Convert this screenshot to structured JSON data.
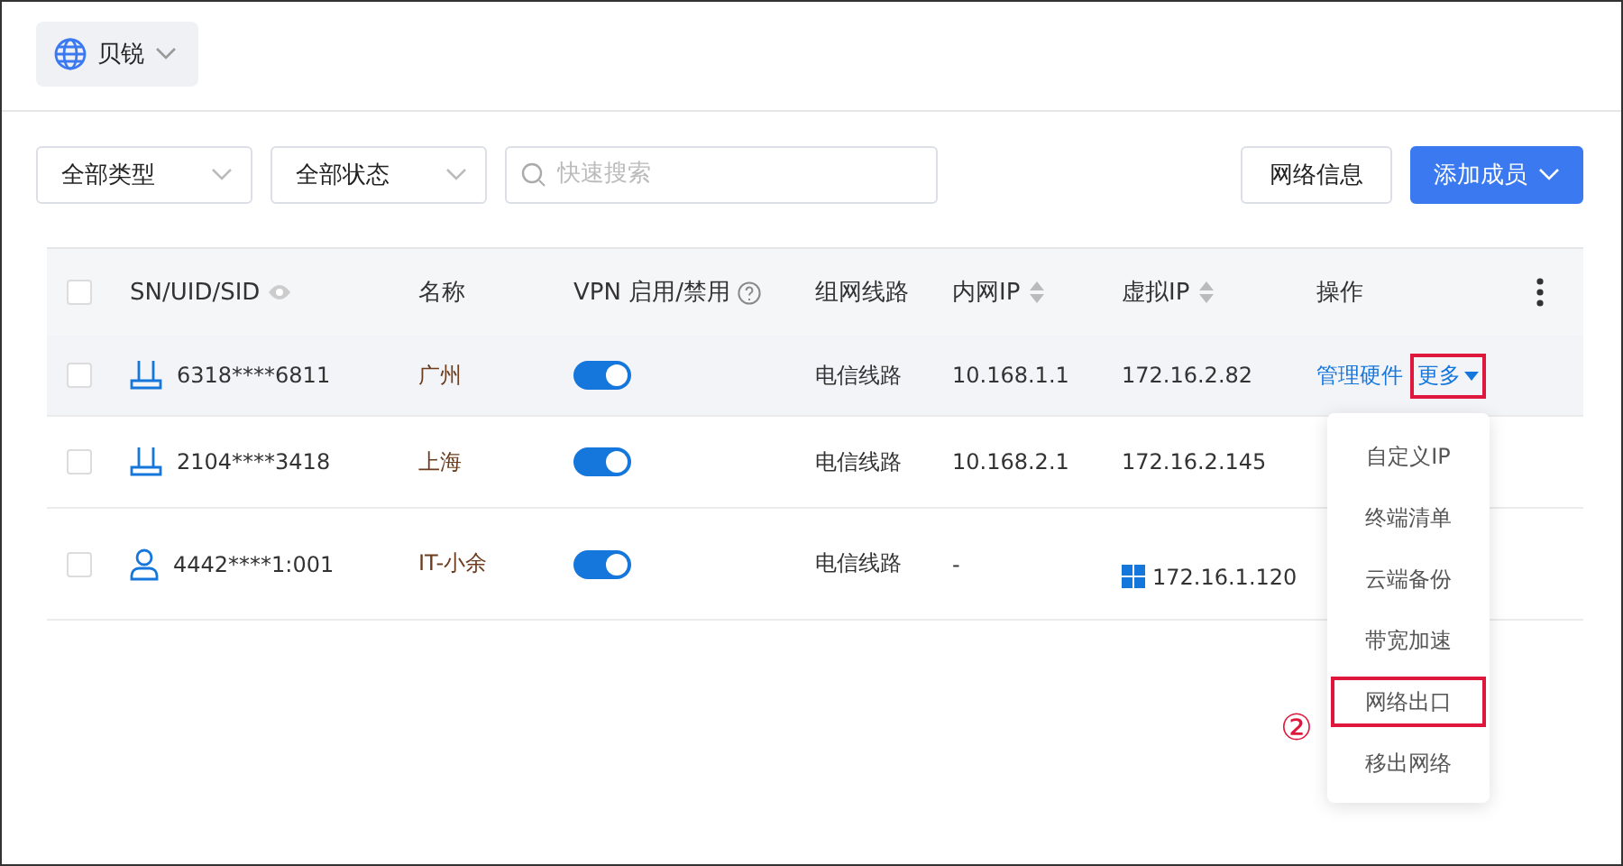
{
  "tenant": {
    "label": "贝锐"
  },
  "filters": [
    {
      "label": "全部类型"
    },
    {
      "label": "全部状态"
    }
  ],
  "search": {
    "placeholder": "快速搜索"
  },
  "buttons": [
    {
      "label": "网络信息",
      "kind": "default"
    },
    {
      "label": "添加成员",
      "kind": "primary"
    }
  ],
  "table": {
    "all_checked": false,
    "columns": [
      "SN/UID/SID",
      "名称",
      "VPN 启用/禁用",
      "组网线路",
      "内网IP",
      "虚拟IP",
      "操作"
    ],
    "rows": [
      {
        "kind": "router",
        "id": "6318****6811",
        "name": "广州",
        "vpn_on": true,
        "line": "电信线路",
        "lan_ip": "10.168.1.1",
        "virtual_ip": "172.16.2.82",
        "windows_icon": false,
        "actions": [
          "管理硬件",
          "更多"
        ],
        "selected": true,
        "checked": false
      },
      {
        "kind": "router",
        "id": "2104****3418",
        "name": "上海",
        "vpn_on": true,
        "line": "电信线路",
        "lan_ip": "10.168.2.1",
        "virtual_ip": "172.16.2.145",
        "windows_icon": false,
        "actions": [],
        "selected": false,
        "checked": false
      },
      {
        "kind": "user",
        "id": "4442****1:001",
        "name": "IT-小余",
        "vpn_on": true,
        "line": "电信线路",
        "lan_ip": "-",
        "virtual_ip": "172.16.1.120",
        "windows_icon": true,
        "actions": [],
        "selected": false,
        "checked": false
      }
    ]
  },
  "menu": {
    "items": [
      {
        "label": "自定义IP",
        "highlighted": false
      },
      {
        "label": "终端清单",
        "highlighted": false
      },
      {
        "label": "云端备份",
        "highlighted": false
      },
      {
        "label": "带宽加速",
        "highlighted": false
      },
      {
        "label": "网络出口",
        "highlighted": true
      },
      {
        "label": "移出网络",
        "highlighted": false
      }
    ]
  },
  "annotation": {
    "label": "②"
  }
}
